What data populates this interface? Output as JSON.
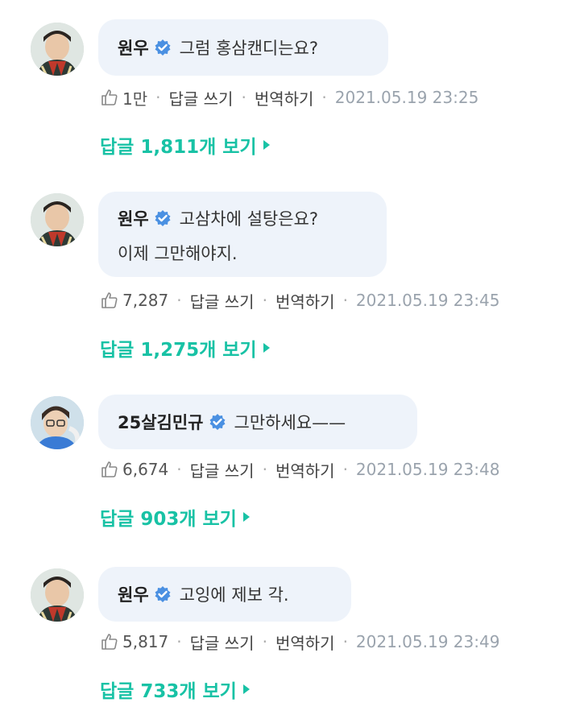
{
  "comments": [
    {
      "author": "원우",
      "text_lines": [
        "그럼 홍삼캔디는요?"
      ],
      "likes": "1만",
      "reply_action": "답글 쓰기",
      "translate_action": "번역하기",
      "date": "2021.05.19 23:25",
      "replies_link": "답글 1,811개 보기",
      "verified_icon": "verified-badge-icon",
      "like_icon": "thumbs-up-icon"
    },
    {
      "author": "원우",
      "text_lines": [
        "고삼차에 설탕은요?",
        "이제 그만해야지."
      ],
      "likes": "7,287",
      "reply_action": "답글 쓰기",
      "translate_action": "번역하기",
      "date": "2021.05.19 23:45",
      "replies_link": "답글 1,275개 보기",
      "verified_icon": "verified-badge-icon",
      "like_icon": "thumbs-up-icon"
    },
    {
      "author": "25살김민규",
      "text_lines": [
        "그만하세요——"
      ],
      "likes": "6,674",
      "reply_action": "답글 쓰기",
      "translate_action": "번역하기",
      "date": "2021.05.19 23:48",
      "replies_link": "답글 903개 보기",
      "verified_icon": "verified-badge-icon",
      "like_icon": "thumbs-up-icon"
    },
    {
      "author": "원우",
      "text_lines": [
        "고잉에 제보 각."
      ],
      "likes": "5,817",
      "reply_action": "답글 쓰기",
      "translate_action": "번역하기",
      "date": "2021.05.19 23:49",
      "replies_link": "답글 733개 보기",
      "verified_icon": "verified-badge-icon",
      "like_icon": "thumbs-up-icon"
    }
  ],
  "colors": {
    "bubble_bg": "#eef3fa",
    "reply_link": "#18c2a5",
    "verified": "#4a90e2",
    "meta_text": "#555555",
    "date_text": "#9aa3ad"
  }
}
